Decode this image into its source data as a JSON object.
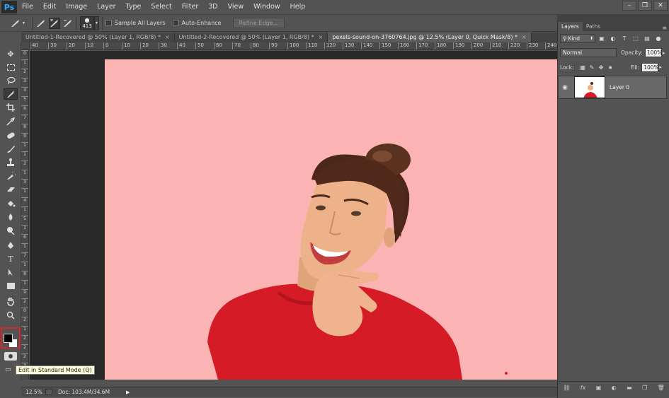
{
  "app": {
    "logo": "Ps"
  },
  "menu": [
    "File",
    "Edit",
    "Image",
    "Layer",
    "Type",
    "Select",
    "Filter",
    "3D",
    "View",
    "Window",
    "Help"
  ],
  "window_buttons": [
    "–",
    "❐",
    "✕"
  ],
  "options": {
    "brush_size": "413",
    "sample_all_layers": "Sample All Layers",
    "auto_enhance": "Auto-Enhance",
    "refine_edge": "Refine Edge..."
  },
  "tabs": [
    {
      "label": "Untitled-1-Recovered @ 50% (Layer 1, RGB/8) *",
      "close": "×"
    },
    {
      "label": "Untitled-2-Recovered @ 50% (Layer 1, RGB/8) *",
      "close": "×"
    },
    {
      "label": "pexels-sound-on-3760764.jpg @ 12.5% (Layer 0, Quick Mask/8) *",
      "close": "×"
    }
  ],
  "ruler_h": [
    "40",
    "30",
    "20",
    "10",
    "0",
    "10",
    "20",
    "30",
    "40",
    "50",
    "60",
    "70",
    "80",
    "90",
    "100",
    "110",
    "120",
    "130",
    "140",
    "150",
    "160",
    "170",
    "180",
    "190",
    "200",
    "210",
    "220",
    "230",
    "240"
  ],
  "ruler_v": [
    "0",
    "1",
    "2",
    "3",
    "4",
    "5",
    "6",
    "7",
    "8",
    "9",
    "1",
    "1",
    "2",
    "1",
    "3",
    "1",
    "4",
    "1",
    "5",
    "1",
    "6",
    "1",
    "7",
    "1",
    "8",
    "1",
    "9",
    "2",
    "0",
    "2",
    "1",
    "2",
    "2",
    "2",
    "3"
  ],
  "tooltip": "Edit in Standard Mode (Q)",
  "status": {
    "zoom": "12.5%",
    "doc": "Doc: 103.4M/34.6M",
    "arrow": "▶"
  },
  "layers_panel": {
    "tabs": [
      "Layers",
      "Paths"
    ],
    "kind": "Kind",
    "blend_mode": "Normal",
    "opacity_label": "Opacity:",
    "opacity_value": "100%",
    "lock_label": "Lock:",
    "fill_label": "Fill:",
    "fill_value": "100%",
    "layer_name": "Layer 0"
  },
  "colors": {
    "canvas": "#fcb3b4",
    "highlight": "#d9242b",
    "shirt": "#d51b26"
  }
}
